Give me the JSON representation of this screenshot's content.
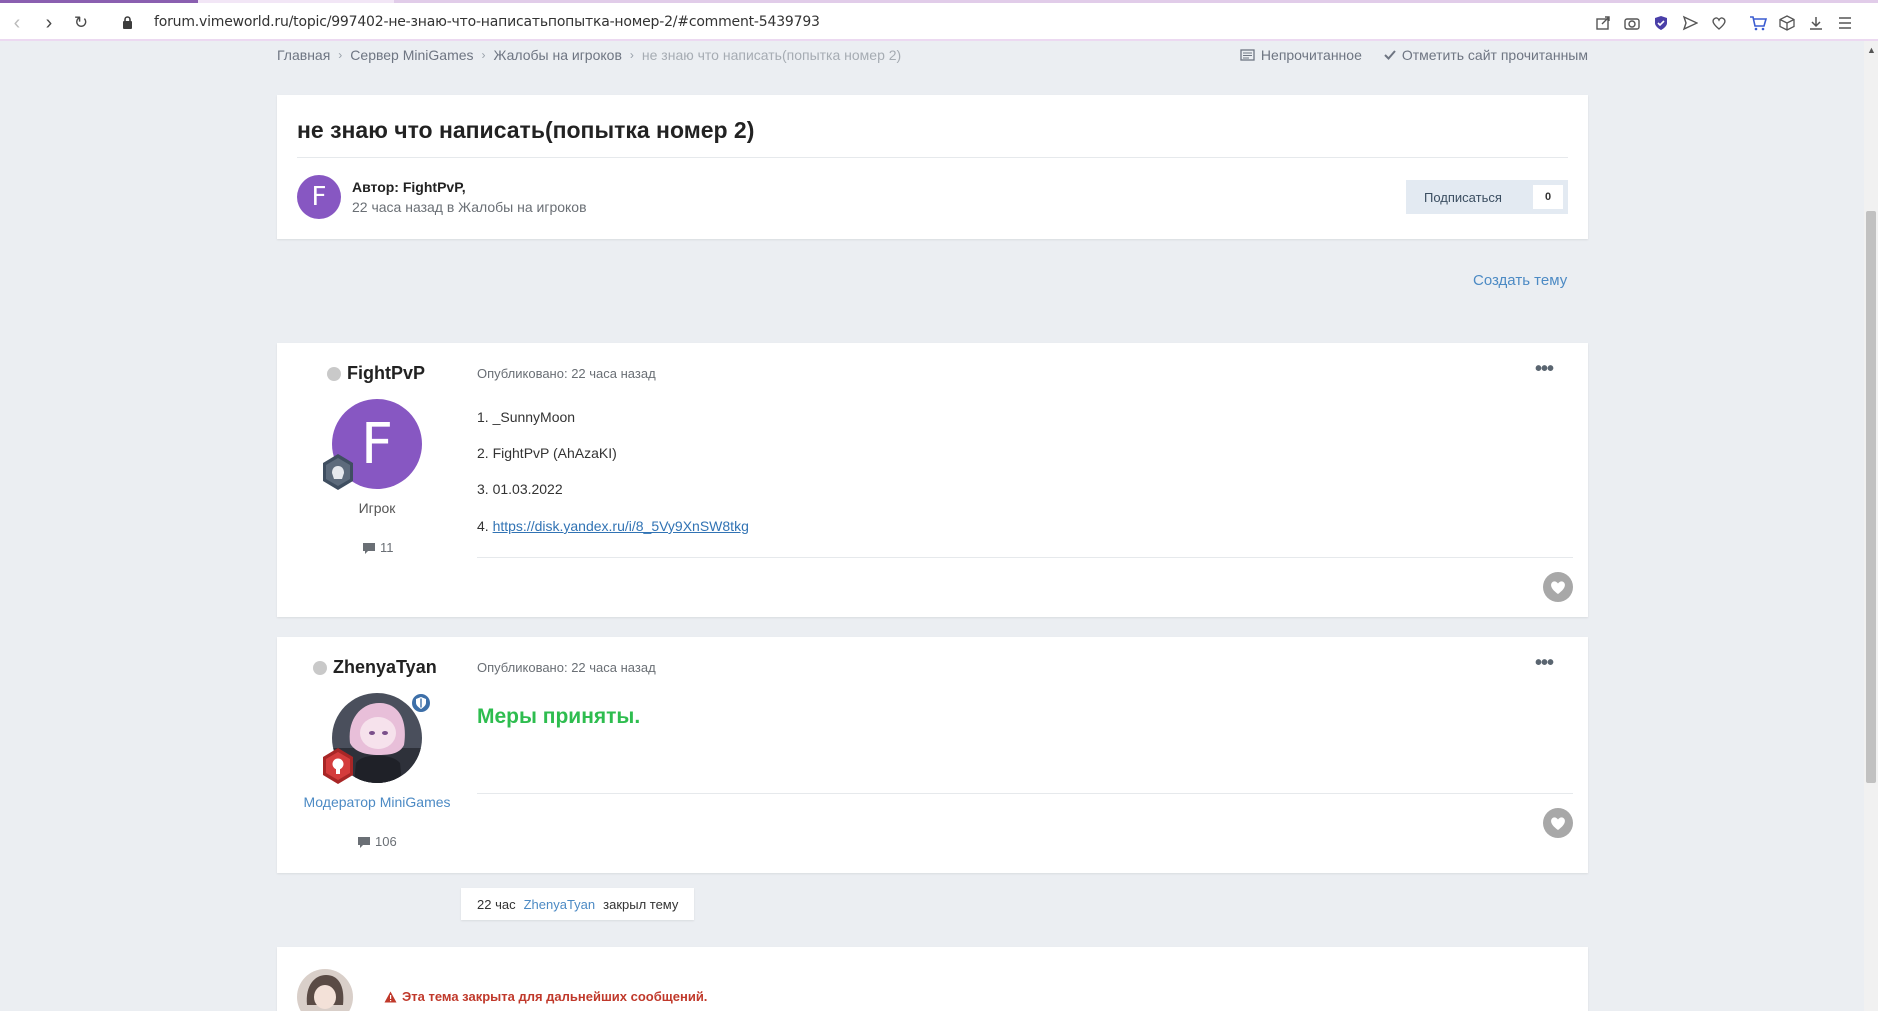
{
  "browser": {
    "url": "forum.vimeworld.ru/topic/997402-не-знаю-что-написатьпопытка-номер-2/#comment-5439793"
  },
  "breadcrumb": {
    "items": [
      "Главная",
      "Сервер MiniGames",
      "Жалобы на игроков"
    ],
    "current": "не знаю что написать(попытка номер 2)",
    "unread": "Непрочитанное",
    "mark_read": "Отметить сайт прочитанным"
  },
  "topic": {
    "title": "не знаю что написать(попытка номер 2)",
    "avatar_letter": "F",
    "author_line": "Автор: FightPvP,",
    "meta_line": "22 часа назад в Жалобы на игроков",
    "follow_label": "Подписаться",
    "follow_count": "0"
  },
  "actions": {
    "new_topic": "Создать тему"
  },
  "posts": [
    {
      "username": "FightPvP",
      "avatar_letter": "F",
      "role": "Игрок",
      "post_count": "11",
      "posted": "Опубликовано: 22 часа назад",
      "lines": [
        "1. _SunnyMoon",
        "2. FightPvP (AhAzaKI)",
        "3. 01.03.2022",
        "4."
      ],
      "link": "https://disk.yandex.ru/i/8_5Vy9XnSW8tkg"
    },
    {
      "username": "ZhenyaTyan",
      "role": "Модератор MiniGames",
      "post_count": "106",
      "posted": "Опубликовано: 22 часа назад",
      "message": "Меры приняты."
    }
  ],
  "event": {
    "time": "22 час",
    "user": "ZhenyaTyan",
    "action": "закрыл тему"
  },
  "closed_notice": "Эта тема закрыта для дальнейших сообщений.",
  "colors": {
    "accent": "#4c8ac4",
    "avatar_purple": "#8757c2",
    "success_green": "#2ebd4f",
    "danger_red": "#c0392b"
  }
}
